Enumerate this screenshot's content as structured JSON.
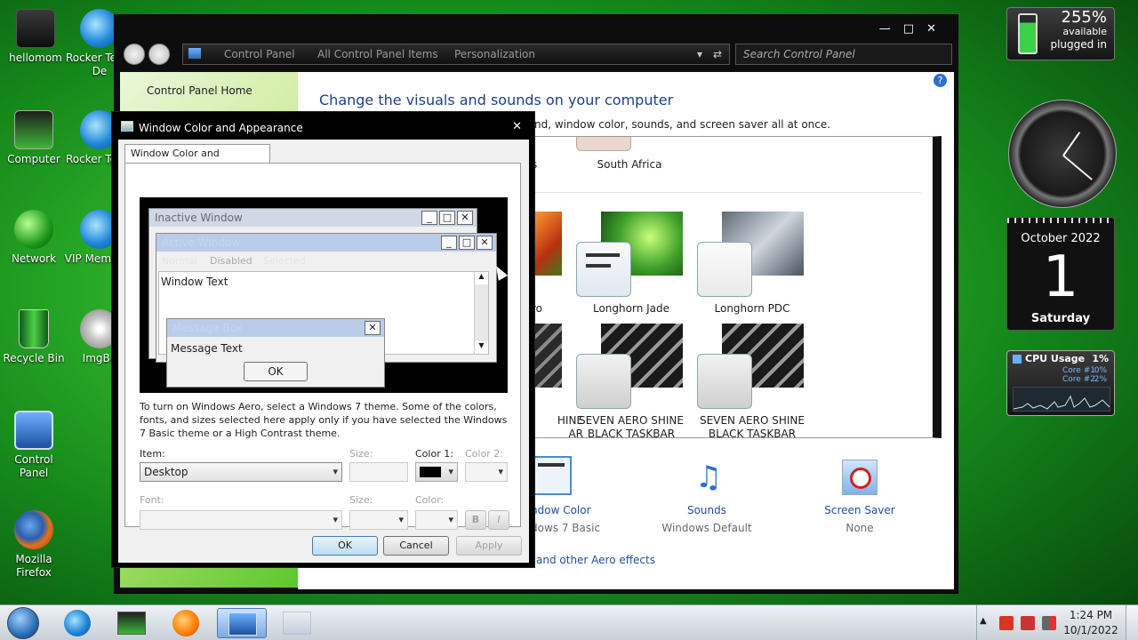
{
  "desktop": {
    "icons": [
      {
        "label": "hellomom"
      },
      {
        "label": "Computer"
      },
      {
        "label": "Network"
      },
      {
        "label": "Recycle Bin"
      },
      {
        "label": "Control Panel"
      },
      {
        "label": "Mozilla Firefox"
      },
      {
        "label": "Rocker Team De"
      },
      {
        "label": "Rocker Team"
      },
      {
        "label": "VIP Members"
      },
      {
        "label": "ImgBu"
      }
    ]
  },
  "explorer": {
    "breadcrumb": [
      "Control Panel",
      "All Control Panel Items",
      "Personalization"
    ],
    "search_placeholder": "Search Control Panel",
    "left_link": "Control Panel Home",
    "heading": "Change the visuals and sounds on your computer",
    "subheading": "nd, window color, sounds, and screen saver all at once.",
    "themes": [
      {
        "name": "South Africa"
      },
      {
        "name": "ro"
      },
      {
        "name": "Longhorn Jade"
      },
      {
        "name": "Longhorn PDC"
      },
      {
        "name": "HINE\nAR"
      },
      {
        "name": "SEVEN AERO SHINE BLACK TASKBAR"
      },
      {
        "name": "SEVEN AERO SHINE BLACK TASKBAR"
      }
    ],
    "bottom": {
      "window_color": {
        "title": "ndow Color",
        "value": "dows 7 Basic"
      },
      "sounds": {
        "title": "Sounds",
        "value": "Windows Default"
      },
      "screen_saver": {
        "title": "Screen Saver",
        "value": "None"
      },
      "aero_link": "and other Aero effects"
    }
  },
  "dialog": {
    "title": "Window Color and Appearance",
    "tab": "Window Color and Appearance",
    "preview": {
      "inactive": "Inactive Window",
      "active": "Active Window",
      "menu_normal": "Normal",
      "menu_disabled": "Disabled",
      "menu_selected": "Selected",
      "window_text": "Window Text",
      "message_title": "Message Box",
      "message_text": "Message Text",
      "ok": "OK"
    },
    "instructions": "To turn on Windows Aero, select a Windows 7 theme.  Some of the colors, fonts, and sizes selected here apply only if you have selected the Windows 7 Basic theme or a High Contrast theme.",
    "item_label": "Item:",
    "item_value": "Desktop",
    "size_label": "Size:",
    "color1_label": "Color 1:",
    "color2_label": "Color 2:",
    "font_label": "Font:",
    "font_size_label": "Size:",
    "font_color_label": "Color:",
    "bold": "B",
    "italic": "I",
    "ok": "OK",
    "cancel": "Cancel",
    "apply": "Apply"
  },
  "gadgets": {
    "battery": {
      "percent": "255%",
      "line1": "available",
      "line2": "plugged in"
    },
    "calendar": {
      "month": "October 2022",
      "day": "1",
      "weekday": "Saturday"
    },
    "cpu": {
      "title": "CPU Usage",
      "total": "1%",
      "core1_label": "Core #1",
      "core1": "0%",
      "core2_label": "Core #2",
      "core2": "2%"
    }
  },
  "taskbar": {
    "time": "1:24 PM",
    "date": "10/1/2022"
  },
  "colors": {
    "accent_link": "#1f4e9a",
    "aero_dark": "#0d0d0d",
    "desktop_green": "#2fb52a"
  }
}
